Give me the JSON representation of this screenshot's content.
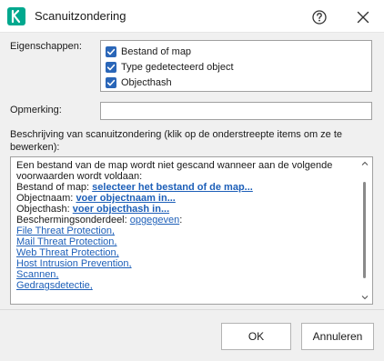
{
  "window": {
    "title": "Scanuitzondering",
    "accent": "#00a88e"
  },
  "properties": {
    "label": "Eigenschappen:",
    "items": [
      {
        "label": "Bestand of map",
        "checked": true
      },
      {
        "label": "Type gedetecteerd object",
        "checked": true
      },
      {
        "label": "Objecthash",
        "checked": true
      }
    ]
  },
  "remark": {
    "label": "Opmerking:",
    "value": ""
  },
  "description": {
    "label": "Beschrijving van scanuitzondering (klik op de onderstreepte items om ze te bewerken):",
    "intro_line1": "Een bestand van de map wordt niet gescand wanneer aan de volgende",
    "intro_line2": "voorwaarden wordt voldaan:",
    "file_label": "Bestand of map:",
    "file_link": "selecteer het bestand of de map...",
    "objname_label": "Objectnaam:",
    "objname_link": "voer objectnaam in...",
    "objhash_label": "Objecthash:",
    "objhash_link": "voer objecthash in...",
    "component_label": "Beschermingsonderdeel:",
    "component_link": "opgegeven",
    "component_suffix": ":",
    "components": [
      "File Threat Protection,",
      "Mail Threat Protection,",
      "Web Threat Protection,",
      "Host Intrusion Prevention,",
      "Scannen,",
      "Gedragsdetectie,"
    ],
    "link_color": "#1d5fb8"
  },
  "footer": {
    "ok_label": "OK",
    "cancel_label": "Annuleren"
  }
}
